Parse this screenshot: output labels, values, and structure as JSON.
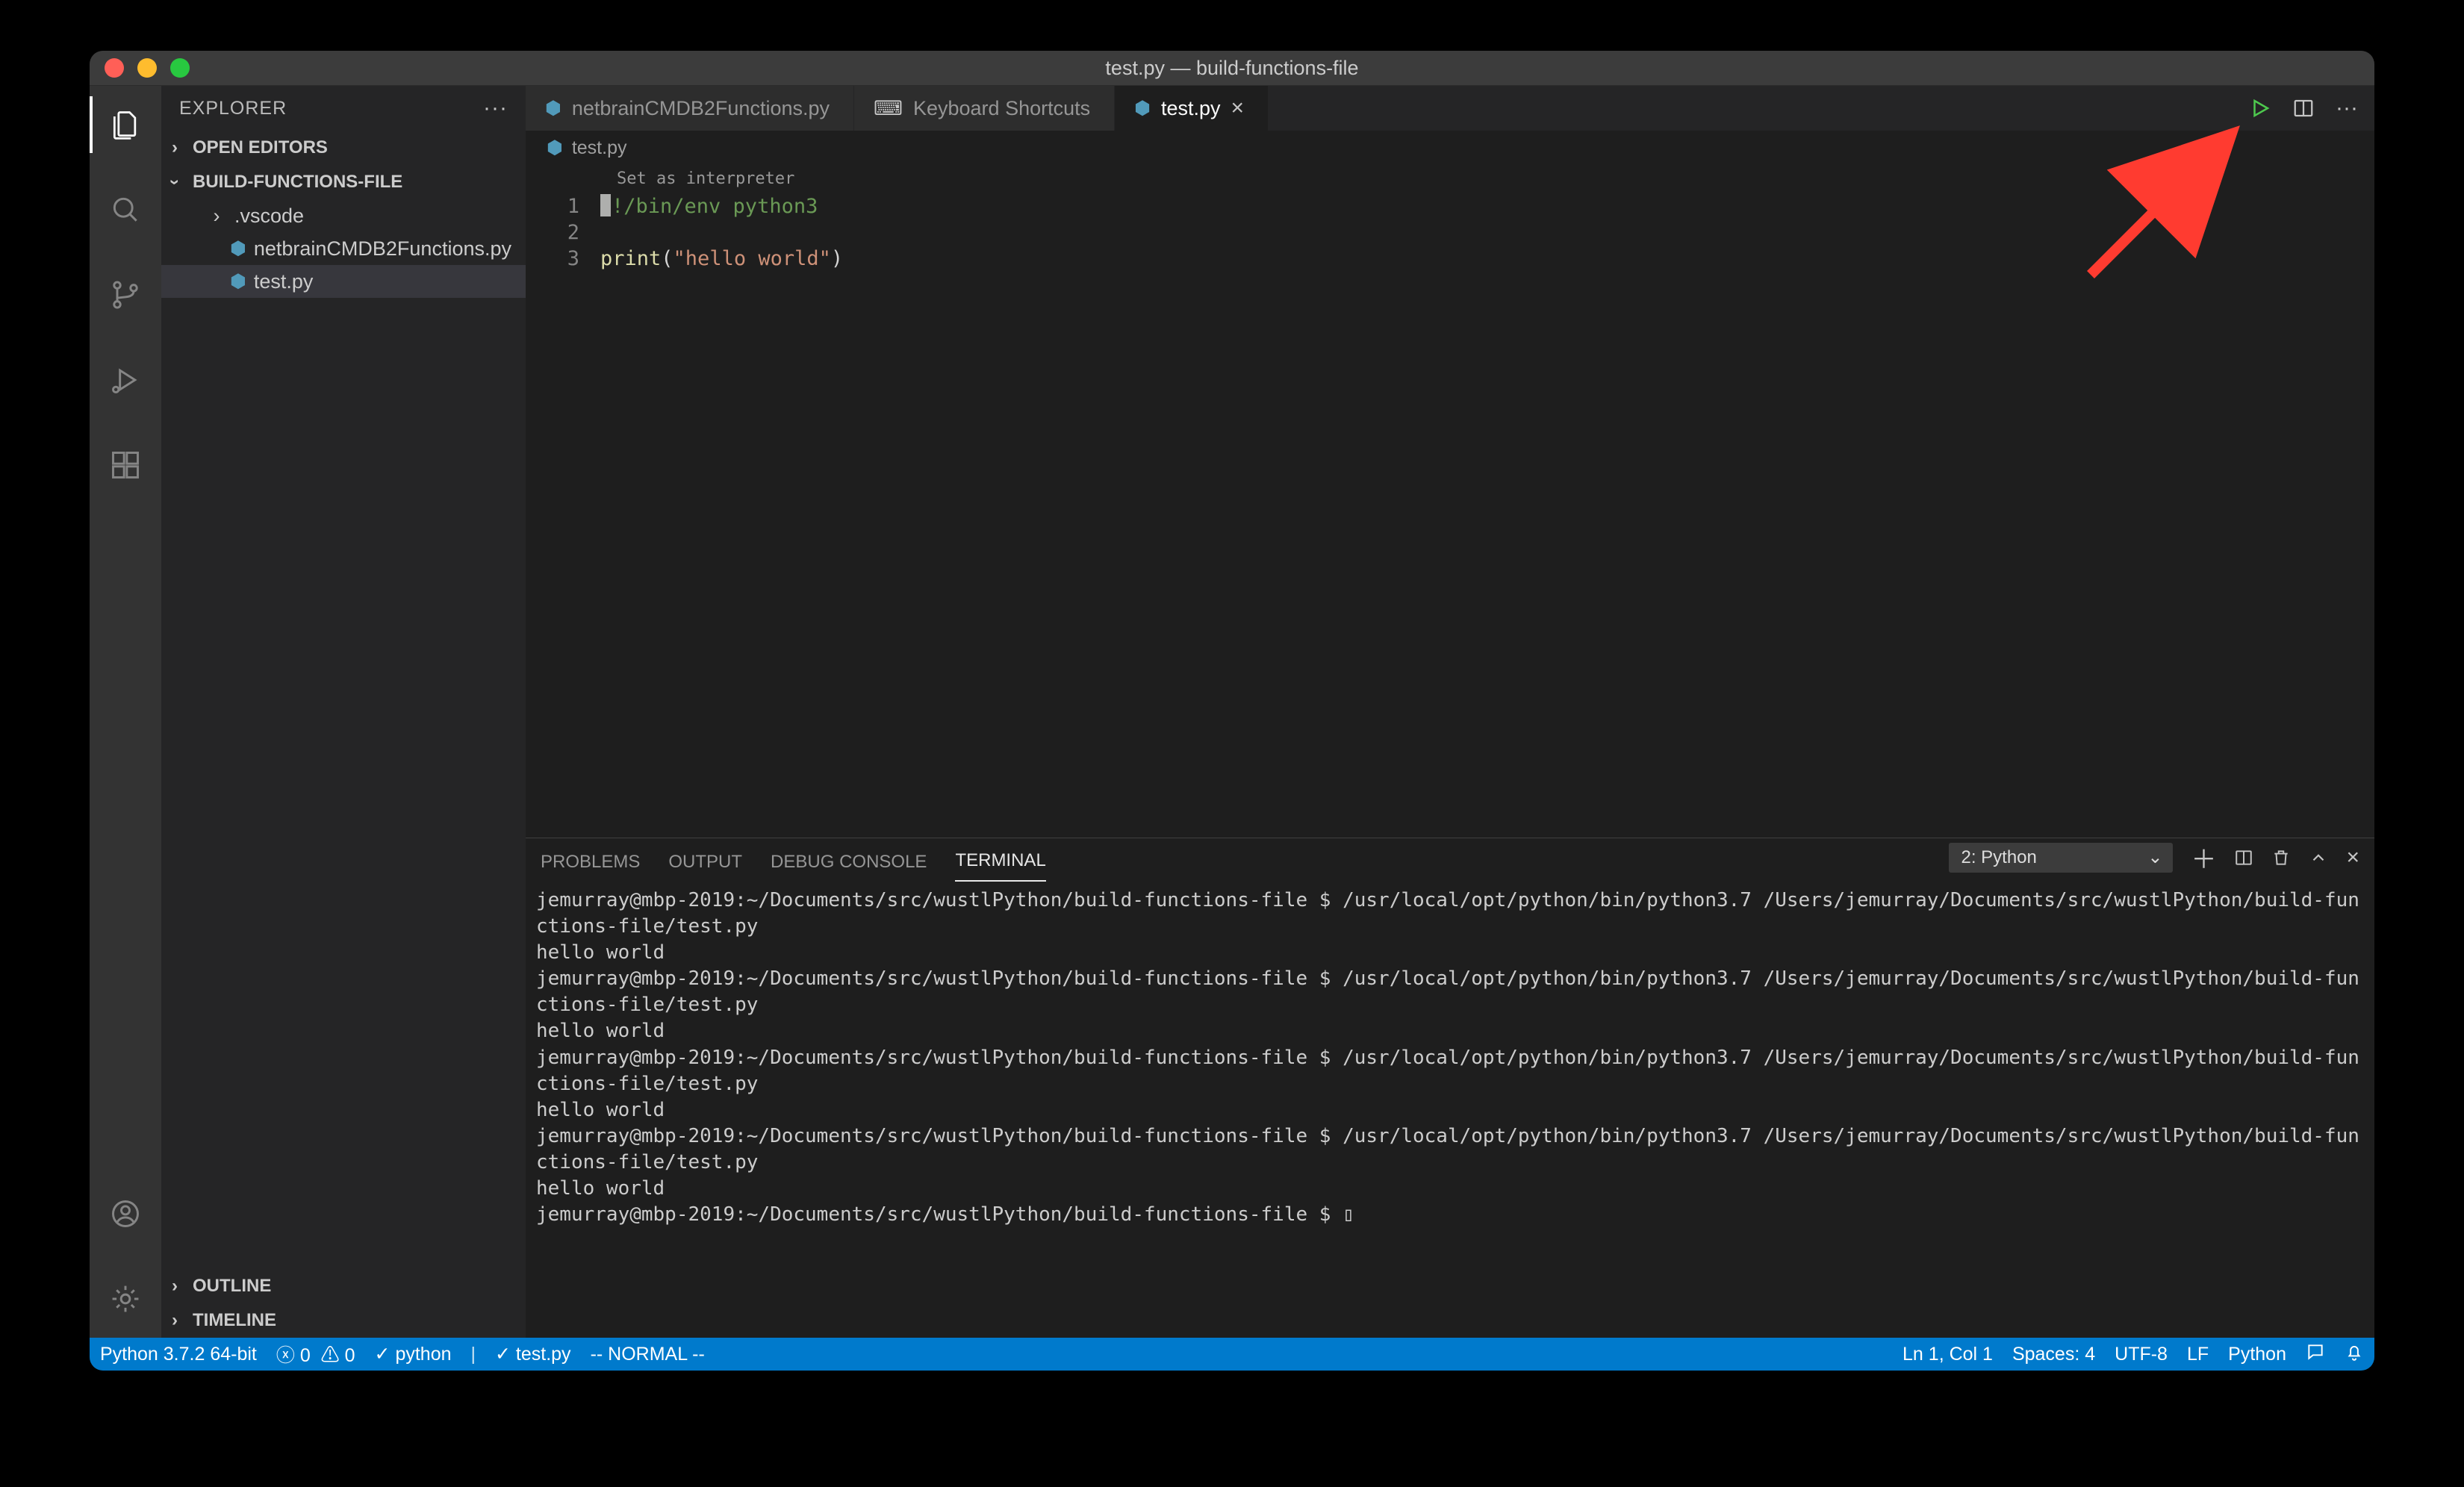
{
  "window": {
    "title": "test.py — build-functions-file",
    "traffic": {
      "close": "#ff5f57",
      "min": "#febc2e",
      "max": "#28c840"
    }
  },
  "activity": {
    "items": [
      "explorer",
      "search",
      "source-control",
      "run",
      "extensions"
    ],
    "bottom": [
      "accounts",
      "settings"
    ]
  },
  "sidebar": {
    "title": "EXPLORER",
    "sections": {
      "open_editors": "OPEN EDITORS",
      "folder": "BUILD-FUNCTIONS-FILE",
      "outline": "OUTLINE",
      "timeline": "TIMELINE"
    },
    "tree": {
      "folder": ".vscode",
      "files": [
        "netbrainCMDB2Functions.py",
        "test.py"
      ],
      "selected": "test.py"
    }
  },
  "tabs": {
    "items": [
      {
        "label": "netbrainCMDB2Functions.py",
        "icon": "python",
        "active": false
      },
      {
        "label": "Keyboard Shortcuts",
        "icon": "keyboard",
        "active": false
      },
      {
        "label": "test.py",
        "icon": "python",
        "active": true
      }
    ]
  },
  "breadcrumb": {
    "file": "test.py"
  },
  "editor": {
    "codelens": "Set as interpreter",
    "lines": [
      "1",
      "2",
      "3"
    ],
    "code": {
      "l1_pre": "#",
      "l1_rest": "!/bin/env python3",
      "l2": "",
      "l3_fn": "print",
      "l3_open": "(",
      "l3_str": "\"hello world\"",
      "l3_close": ")"
    }
  },
  "panel": {
    "tabs": [
      "PROBLEMS",
      "OUTPUT",
      "DEBUG CONSOLE",
      "TERMINAL"
    ],
    "active": "TERMINAL",
    "terminal_select": "2: Python",
    "terminal_lines": [
      "jemurray@mbp-2019:~/Documents/src/wustlPython/build-functions-file $ /usr/local/opt/python/bin/python3.7 /Users/jemurray/Documents/src/wustlPython/build-functions-file/test.py",
      "hello world",
      "jemurray@mbp-2019:~/Documents/src/wustlPython/build-functions-file $ /usr/local/opt/python/bin/python3.7 /Users/jemurray/Documents/src/wustlPython/build-functions-file/test.py",
      "hello world",
      "jemurray@mbp-2019:~/Documents/src/wustlPython/build-functions-file $ /usr/local/opt/python/bin/python3.7 /Users/jemurray/Documents/src/wustlPython/build-functions-file/test.py",
      "hello world",
      "jemurray@mbp-2019:~/Documents/src/wustlPython/build-functions-file $ /usr/local/opt/python/bin/python3.7 /Users/jemurray/Documents/src/wustlPython/build-functions-file/test.py",
      "hello world",
      "jemurray@mbp-2019:~/Documents/src/wustlPython/build-functions-file $ ▯"
    ]
  },
  "status": {
    "left": {
      "interpreter": "Python 3.7.2 64-bit",
      "errors": "0",
      "warnings": "0",
      "check1": "python",
      "check2": "test.py",
      "vim": "-- NORMAL --"
    },
    "right": {
      "pos": "Ln 1, Col 1",
      "spaces": "Spaces: 4",
      "encoding": "UTF-8",
      "eol": "LF",
      "lang": "Python"
    }
  },
  "annotation": {
    "color": "#ff3b30"
  }
}
